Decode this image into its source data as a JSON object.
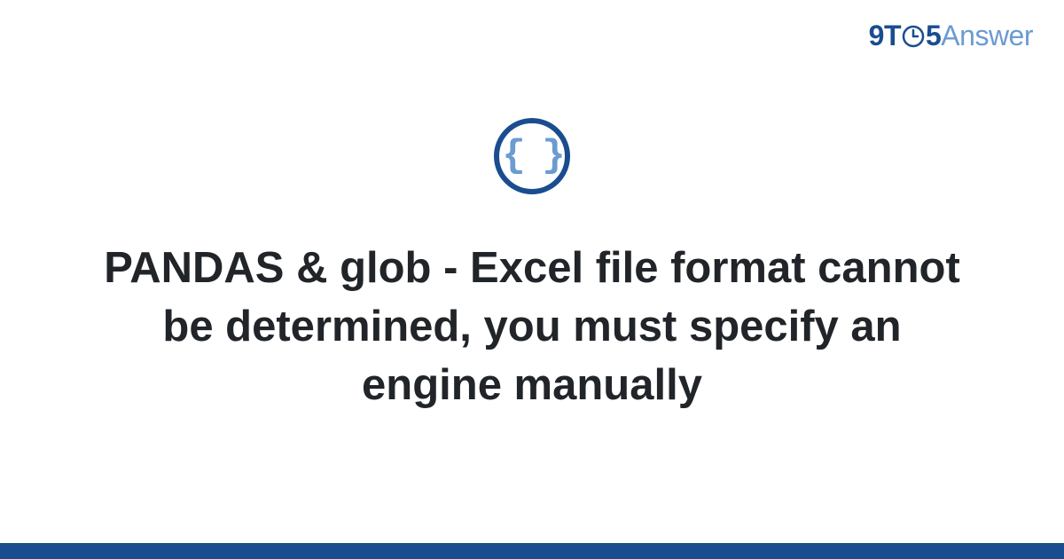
{
  "brand": {
    "prefix": "9T",
    "middle": "5",
    "suffix": "Answer"
  },
  "icon": {
    "braces": "{ }"
  },
  "headline": "PANDAS & glob - Excel file format cannot be determined, you must specify an engine manually",
  "colors": {
    "primary": "#1a4d8f",
    "secondary": "#6b9bd1",
    "text": "#212529"
  }
}
